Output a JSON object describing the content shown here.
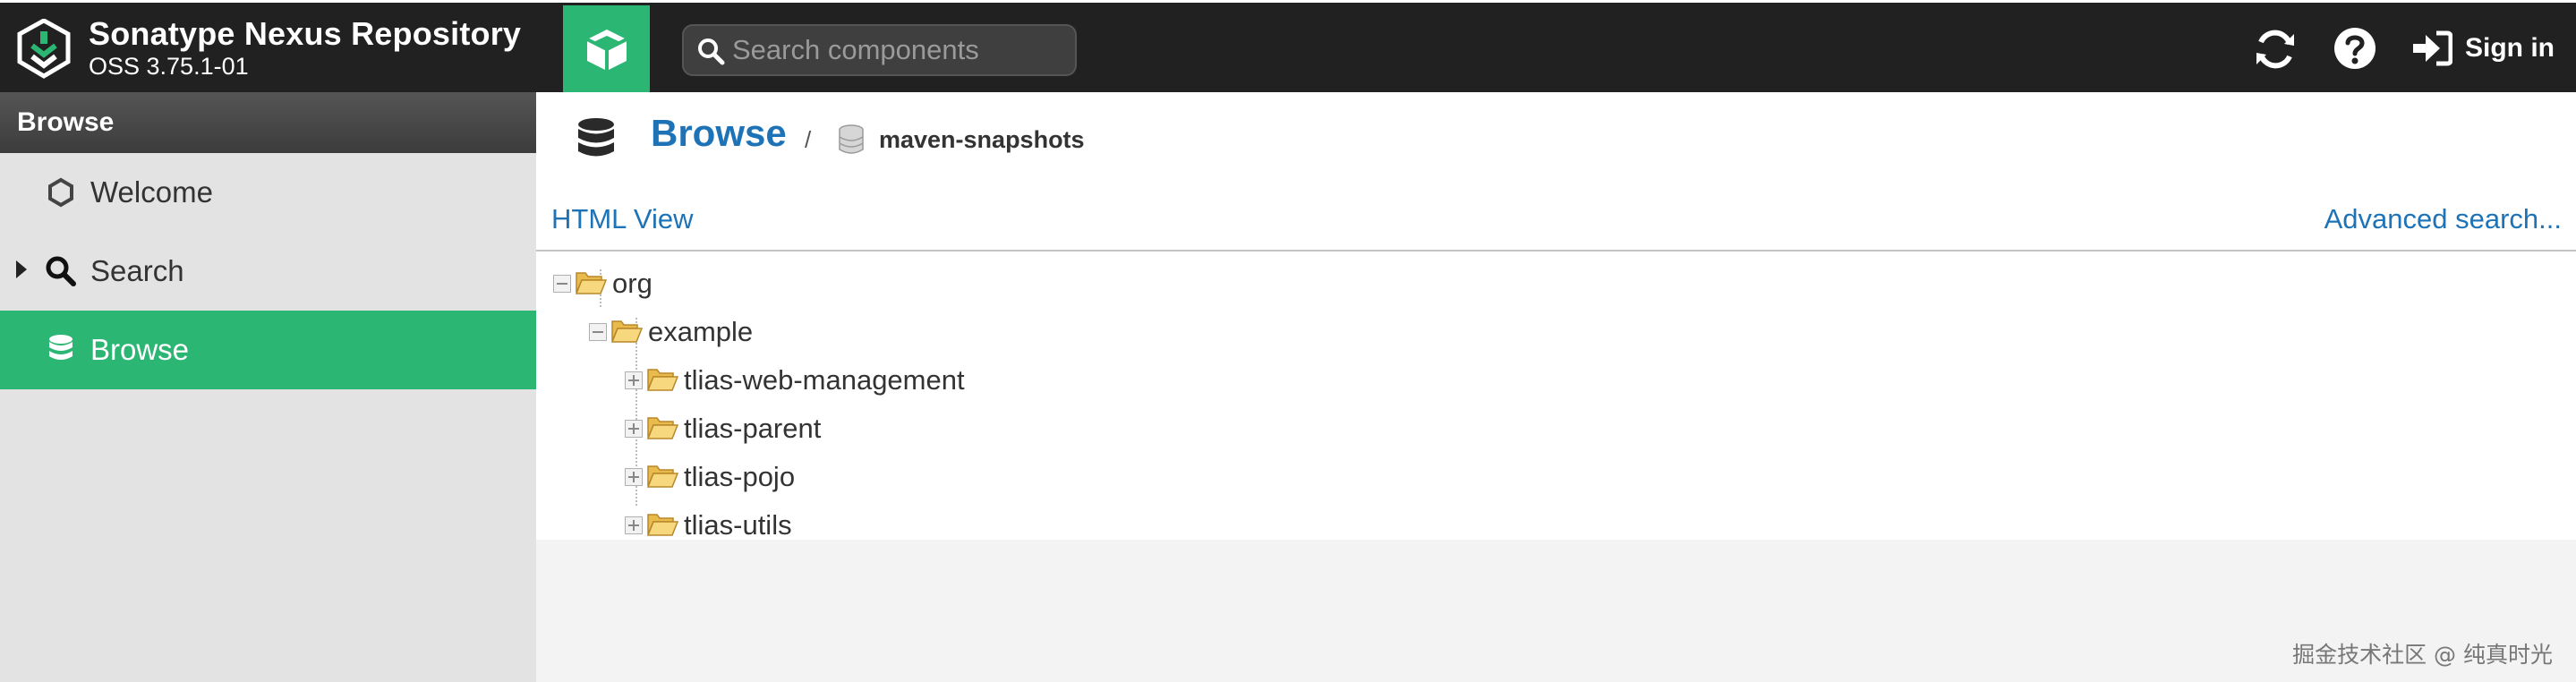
{
  "header": {
    "title": "Sonatype Nexus Repository",
    "version": "OSS 3.75.1-01",
    "search_placeholder": "Search components",
    "sign_in_label": "Sign in",
    "icons": [
      "logo-icon",
      "cube-icon",
      "search-icon",
      "refresh-icon",
      "help-icon",
      "sign-in-icon"
    ],
    "accent_color": "#2bb673"
  },
  "sidebar": {
    "title": "Browse",
    "items": [
      {
        "label": "Welcome",
        "icon": "hexagon-icon",
        "active": false
      },
      {
        "label": "Search",
        "icon": "search-icon",
        "active": false,
        "collapsed": true
      },
      {
        "label": "Browse",
        "icon": "database-icon",
        "active": true
      }
    ]
  },
  "main": {
    "breadcrumb": {
      "title": "Browse",
      "separator": "/",
      "repository": "maven-snapshots"
    },
    "toolbar": {
      "html_view": "HTML View",
      "advanced_search": "Advanced search..."
    },
    "tree": [
      {
        "label": "org",
        "level": 0,
        "expanded": true
      },
      {
        "label": "example",
        "level": 1,
        "expanded": true
      },
      {
        "label": "tlias-web-management",
        "level": 2,
        "expanded": false
      },
      {
        "label": "tlias-parent",
        "level": 2,
        "expanded": false
      },
      {
        "label": "tlias-pojo",
        "level": 2,
        "expanded": false
      },
      {
        "label": "tlias-utils",
        "level": 2,
        "expanded": false
      }
    ]
  },
  "watermark": "掘金技术社区 @ 纯真时光"
}
